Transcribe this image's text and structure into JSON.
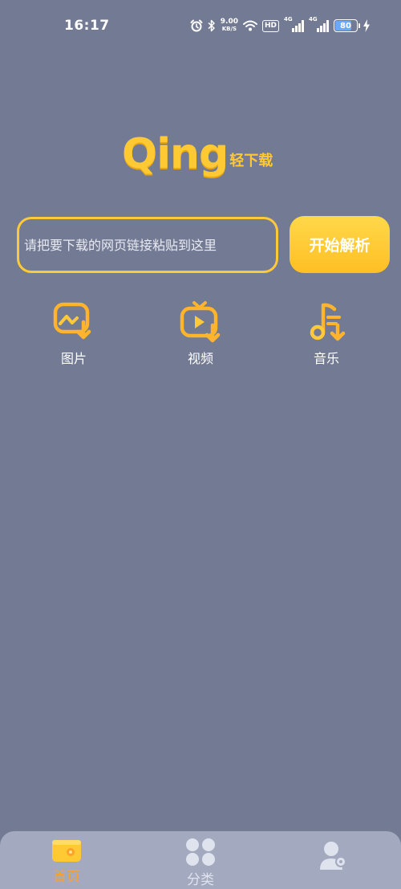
{
  "status_bar": {
    "time": "16:17",
    "net_speed_value": "9.00",
    "net_speed_unit": "KB/S",
    "hd_label": "HD",
    "signal1_label": "4G",
    "signal2_label": "4G",
    "battery_level": "80",
    "battery_color": "#6aa9ff"
  },
  "logo": {
    "main": "Qing",
    "sub": "轻下载",
    "color": "#ffc934"
  },
  "search": {
    "placeholder": "请把要下载的网页链接粘贴到这里",
    "value": "",
    "button_label": "开始解析",
    "accent": "#ffc93a"
  },
  "shortcuts": [
    {
      "label": "图片",
      "icon": "image-download-icon"
    },
    {
      "label": "视频",
      "icon": "tv-play-download-icon"
    },
    {
      "label": "音乐",
      "icon": "music-note-download-icon"
    }
  ],
  "bottom_nav": {
    "items": [
      {
        "label": "首页",
        "icon": "home-wallet-icon",
        "active": true,
        "color": "#ffa126"
      },
      {
        "label": "分类",
        "icon": "grid-four-icon",
        "active": false,
        "color": "#dfe3ee"
      },
      {
        "label": "",
        "icon": "user-gear-icon",
        "active": false,
        "color": "#dfe3ee"
      }
    ]
  }
}
